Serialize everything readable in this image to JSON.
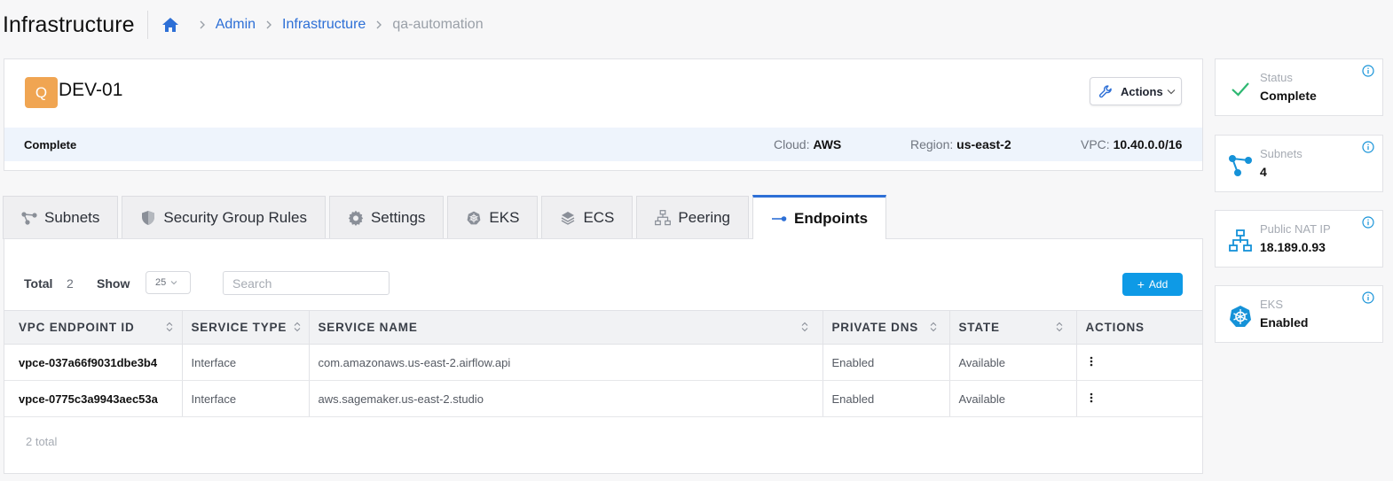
{
  "header": {
    "title": "Infrastructure",
    "breadcrumbs": [
      "Admin",
      "Infrastructure"
    ],
    "current": "qa-automation"
  },
  "card": {
    "avatar_letter": "Q",
    "name": "DEV-01",
    "actions_label": "Actions",
    "status": "Complete",
    "cloud_label": "Cloud:",
    "cloud_value": "AWS",
    "region_label": "Region:",
    "region_value": "us-east-2",
    "vpc_label": "VPC:",
    "vpc_value": "10.40.0.0/16"
  },
  "stats": [
    {
      "label": "Status",
      "value": "Complete",
      "icon": "check-icon"
    },
    {
      "label": "Subnets",
      "value": "4",
      "icon": "subnet-icon"
    },
    {
      "label": "Public NAT IP",
      "value": "18.189.0.93",
      "icon": "network-icon"
    },
    {
      "label": "EKS",
      "value": "Enabled",
      "icon": "kubernetes-icon"
    }
  ],
  "tabs": [
    {
      "label": "Subnets",
      "icon": "subnet-icon"
    },
    {
      "label": "Security Group Rules",
      "icon": "shield-icon"
    },
    {
      "label": "Settings",
      "icon": "gear-icon"
    },
    {
      "label": "EKS",
      "icon": "kubernetes-icon"
    },
    {
      "label": "ECS",
      "icon": "layers-icon"
    },
    {
      "label": "Peering",
      "icon": "network-icon"
    },
    {
      "label": "Endpoints",
      "icon": "endpoint-icon",
      "active": true
    }
  ],
  "toolbar": {
    "total_label": "Total",
    "total_value": "2",
    "show_label": "Show",
    "show_value": "25",
    "search_placeholder": "Search",
    "add_label": "Add"
  },
  "table": {
    "columns": [
      "VPC Endpoint ID",
      "Service Type",
      "Service Name",
      "Private DNS",
      "State",
      "Actions"
    ],
    "rows": [
      [
        "vpce-037a66f9031dbe3b4",
        "Interface",
        "com.amazonaws.us-east-2.airflow.api",
        "Enabled",
        "Available"
      ],
      [
        "vpce-0775c3a9943aec53a",
        "Interface",
        "aws.sagemaker.us-east-2.studio",
        "Enabled",
        "Available"
      ]
    ],
    "footer": "2 total"
  },
  "colors": {
    "accent": "#2d6fd6",
    "avatar": "#f0a552",
    "add_button": "#0e9ae6",
    "check": "#2eb872",
    "icon_blue": "#1592d8"
  }
}
